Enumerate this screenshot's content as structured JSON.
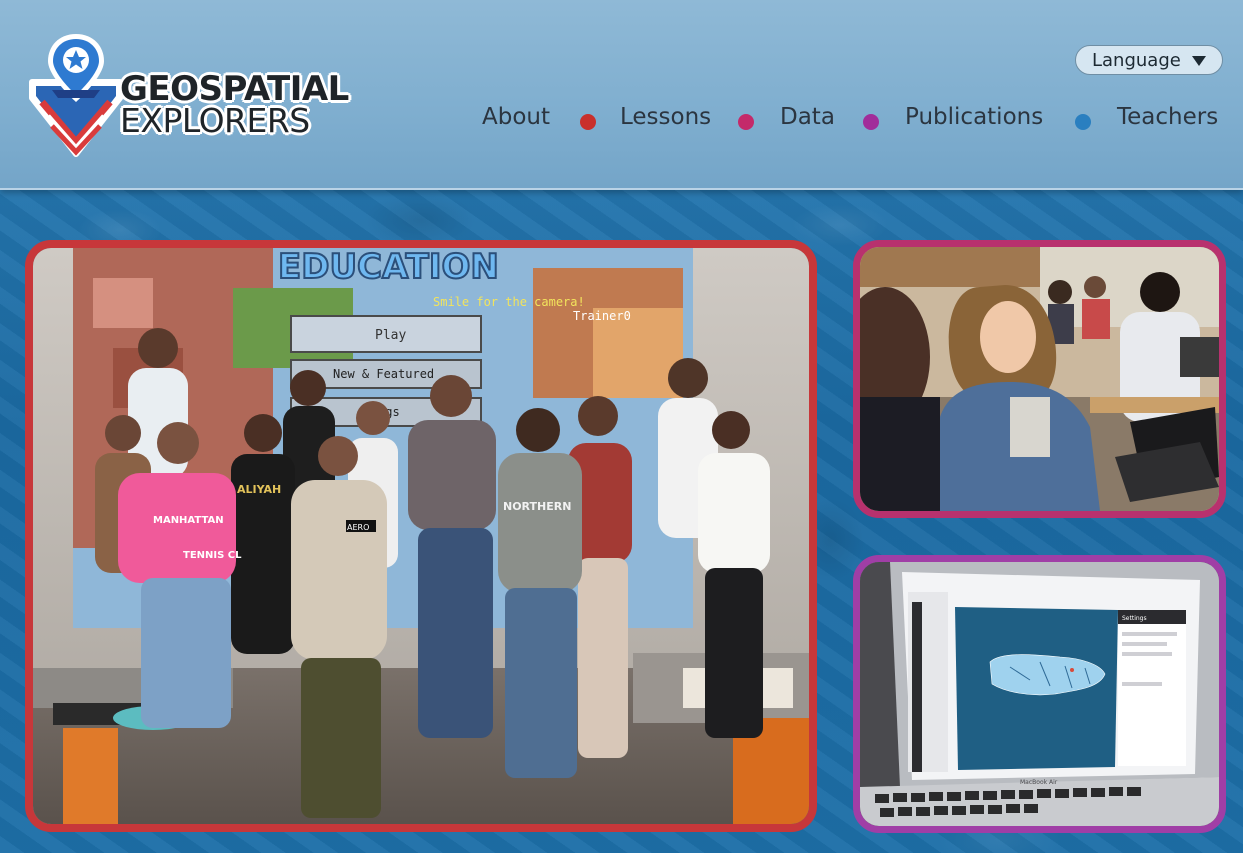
{
  "brand": {
    "line1": "GEOSPATIAL",
    "line2": "EXPLORERS"
  },
  "language": {
    "label": "Language"
  },
  "nav": [
    {
      "label": "About"
    },
    {
      "label": "Lessons"
    },
    {
      "label": "Data"
    },
    {
      "label": "Publications"
    },
    {
      "label": "Teachers"
    }
  ],
  "nav_dot_colors": [
    "#c9302c",
    "#c42a6a",
    "#a12d9a",
    "#2a7fc0"
  ],
  "photos": {
    "main": {
      "screen_title": "EDUCATION",
      "screen_subtitle": "Smile for the camera!",
      "screen_user": "Trainer0",
      "play_label": "Play",
      "featured_label": "New & Featured",
      "settings_label": "ngs",
      "shirt_text": "MANHATTAN",
      "shirt_text2": "TENNIS CL",
      "tee_text": "ALIYAH",
      "hoodie_text": "NORTHERN",
      "tag_text": "AERO"
    },
    "laptop": {
      "sidebar_title": "Settings",
      "brand": "MacBook Air"
    }
  },
  "colors": {
    "main_border": "#c7373a",
    "top_border": "#b8316e",
    "bottom_border": "#a03ea6"
  }
}
